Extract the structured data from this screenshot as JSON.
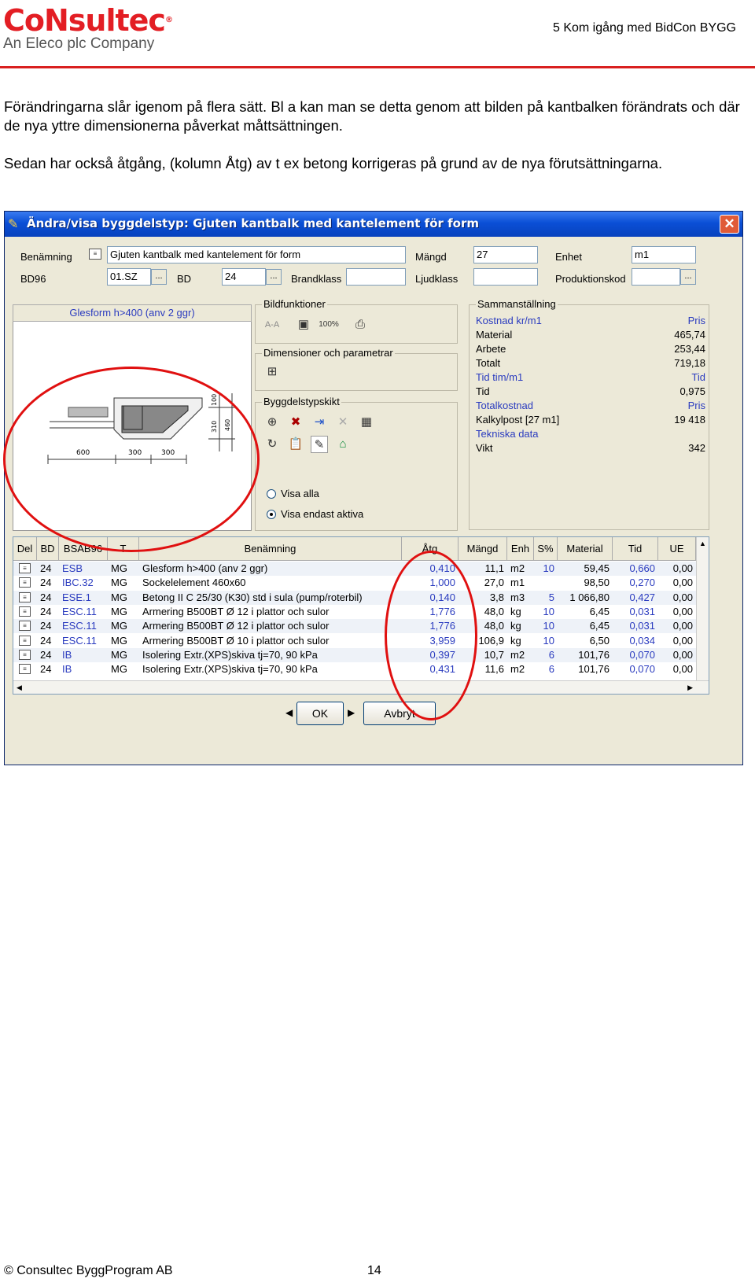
{
  "header": {
    "logo_main": "CoNsultec",
    "logo_sub": "An Eleco plc Company",
    "chapter": "5 Kom igång med BidCon BYGG"
  },
  "body": {
    "para1": "Förändringarna slår igenom på flera sätt. Bl a kan man se detta genom att bilden på kantbalken förändrats och där de nya yttre dimensionerna påverkat måttsättningen.",
    "para2": "Sedan har också åtgång, (kolumn Åtg) av t ex betong korrigeras på grund av de nya förutsättningarna."
  },
  "dialog": {
    "title": "Ändra/visa byggdelstyp: Gjuten kantbalk med kantelement för form",
    "close_glyph": "✕",
    "fields": {
      "benamning_label": "Benämning",
      "benamning_value": "Gjuten kantbalk med kantelement för form",
      "mangd_label": "Mängd",
      "mangd_value": "27",
      "enhet_label": "Enhet",
      "enhet_value": "m1",
      "bd96_label": "BD96",
      "bd96_value": "01.SZ",
      "bd_label": "BD",
      "bd_value": "24",
      "brandklass_label": "Brandklass",
      "brandklass_value": "",
      "ljudklass_label": "Ljudklass",
      "ljudklass_value": "",
      "produktionskod_label": "Produktionskod",
      "produktionskod_value": "",
      "dots": "..."
    },
    "image_caption": "Glesform h>400 (anv 2 ggr)",
    "drawing": {
      "dim_bottom": [
        "600",
        "300",
        "300"
      ],
      "dim_right": [
        "100",
        "310",
        "460"
      ]
    },
    "groups": {
      "bildfunktioner": "Bildfunktioner",
      "bild_aa": "A-A",
      "bild_zoom": "100%",
      "dimensioner": "Dimensioner och parametrar",
      "byggdelstypskikt": "Byggdelstypskikt"
    },
    "radio": {
      "visa_alla": "Visa alla",
      "visa_aktiva": "Visa endast aktiva"
    },
    "summary": {
      "title": "Sammanställning",
      "rows": [
        {
          "k": "Kostnad kr/m1",
          "v": "Pris",
          "blue": true
        },
        {
          "k": "Material",
          "v": "465,74",
          "blue": false
        },
        {
          "k": "Arbete",
          "v": "253,44",
          "blue": false
        },
        {
          "k": "Totalt",
          "v": "719,18",
          "blue": false
        },
        {
          "k": "Tid tim/m1",
          "v": "Tid",
          "blue": true
        },
        {
          "k": "Tid",
          "v": "0,975",
          "blue": false
        },
        {
          "k": "Totalkostnad",
          "v": "Pris",
          "blue": true
        },
        {
          "k": "Kalkylpost [27 m1]",
          "v": "19 418",
          "blue": false
        },
        {
          "k": "Tekniska data",
          "v": "",
          "blue": true
        },
        {
          "k": "Vikt",
          "v": "342",
          "blue": false
        }
      ]
    },
    "grid": {
      "headers": [
        "Del",
        "BD",
        "BSAB96",
        "T",
        "Benämning",
        "Åtg",
        "Mängd",
        "Enh",
        "S%",
        "Material",
        "Tid",
        "UE"
      ],
      "rows": [
        [
          "24",
          "ESB",
          "MG",
          "Glesform h>400 (anv 2 ggr)",
          "0,410",
          "11,1",
          "m2",
          "10",
          "59,45",
          "0,660",
          "0,00"
        ],
        [
          "24",
          "IBC.32",
          "MG",
          "Sockelelement 460x60",
          "1,000",
          "27,0",
          "m1",
          "",
          "98,50",
          "0,270",
          "0,00"
        ],
        [
          "24",
          "ESE.1",
          "MG",
          "Betong II C 25/30 (K30) std i sula (pump/roterbil)",
          "0,140",
          "3,8",
          "m3",
          "5",
          "1 066,80",
          "0,427",
          "0,00"
        ],
        [
          "24",
          "ESC.11",
          "MG",
          "Armering B500BT Ø 12 i plattor och sulor",
          "1,776",
          "48,0",
          "kg",
          "10",
          "6,45",
          "0,031",
          "0,00"
        ],
        [
          "24",
          "ESC.11",
          "MG",
          "Armering B500BT Ø 12 i plattor och sulor",
          "1,776",
          "48,0",
          "kg",
          "10",
          "6,45",
          "0,031",
          "0,00"
        ],
        [
          "24",
          "ESC.11",
          "MG",
          "Armering B500BT Ø 10 i plattor och sulor",
          "3,959",
          "106,9",
          "kg",
          "10",
          "6,50",
          "0,034",
          "0,00"
        ],
        [
          "24",
          "IB",
          "MG",
          "Isolering Extr.(XPS)skiva tj=70,  90 kPa",
          "0,397",
          "10,7",
          "m2",
          "6",
          "101,76",
          "0,070",
          "0,00"
        ],
        [
          "24",
          "IB",
          "MG",
          "Isolering Extr.(XPS)skiva tj=70,  90 kPa",
          "0,431",
          "11,6",
          "m2",
          "6",
          "101,76",
          "0,070",
          "0,00"
        ]
      ]
    },
    "buttons": {
      "ok": "OK",
      "cancel": "Avbryt"
    }
  },
  "footer": {
    "copyright": "© Consultec ByggProgram AB",
    "page": "14"
  }
}
